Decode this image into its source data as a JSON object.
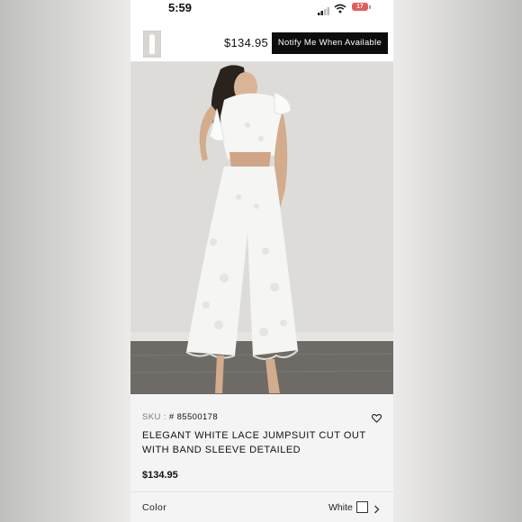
{
  "status_bar": {
    "time": "5:59",
    "battery": "17",
    "icons": [
      "signal-icon",
      "wifi-icon",
      "battery-icon"
    ]
  },
  "top_bar": {
    "price": "$134.95",
    "notify_label": "Notify Me When Available"
  },
  "gallery": {
    "image_count": 2,
    "active_index": 0
  },
  "product": {
    "sku_prefix": "SKU :",
    "sku_value": "# 85500178",
    "title": "ELEGANT WHITE LACE JUMPSUIT CUT OUT WITH BAND SLEEVE DETAILED",
    "price": "$134.95",
    "color_label": "Color",
    "color_value": "White"
  },
  "colors": {
    "button_bg": "#0c0c0c",
    "battery": "#e35d58",
    "details_bg": "#f4f4f4"
  }
}
